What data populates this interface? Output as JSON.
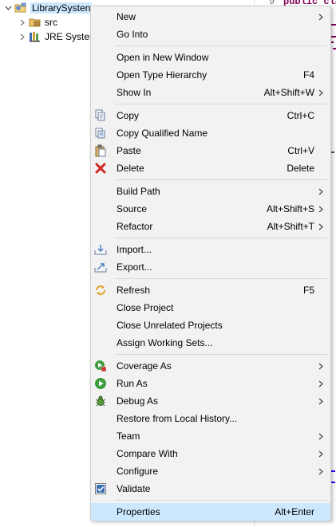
{
  "explorer": {
    "project": {
      "label": "LibrarySysten"
    },
    "items": [
      {
        "label": "src"
      },
      {
        "label": "JRE System"
      }
    ]
  },
  "editor": {
    "line_number": "9",
    "code_fragment": "public cla"
  },
  "menu": {
    "items": [
      {
        "label": "New",
        "shortcut": "",
        "submenu": true,
        "icon": ""
      },
      {
        "label": "Go Into",
        "shortcut": "",
        "submenu": false,
        "icon": ""
      },
      {
        "label": "Open in New Window",
        "shortcut": "",
        "submenu": false,
        "icon": ""
      },
      {
        "label": "Open Type Hierarchy",
        "shortcut": "F4",
        "submenu": false,
        "icon": ""
      },
      {
        "label": "Show In",
        "shortcut": "Alt+Shift+W",
        "submenu": true,
        "icon": ""
      },
      {
        "label": "Copy",
        "shortcut": "Ctrl+C",
        "submenu": false,
        "icon": "copy-icon"
      },
      {
        "label": "Copy Qualified Name",
        "shortcut": "",
        "submenu": false,
        "icon": "copy-qualified-name-icon"
      },
      {
        "label": "Paste",
        "shortcut": "Ctrl+V",
        "submenu": false,
        "icon": "paste-icon"
      },
      {
        "label": "Delete",
        "shortcut": "Delete",
        "submenu": false,
        "icon": "delete-icon"
      },
      {
        "label": "Build Path",
        "shortcut": "",
        "submenu": true,
        "icon": ""
      },
      {
        "label": "Source",
        "shortcut": "Alt+Shift+S",
        "submenu": true,
        "icon": ""
      },
      {
        "label": "Refactor",
        "shortcut": "Alt+Shift+T",
        "submenu": true,
        "icon": ""
      },
      {
        "label": "Import...",
        "shortcut": "",
        "submenu": false,
        "icon": "import-icon"
      },
      {
        "label": "Export...",
        "shortcut": "",
        "submenu": false,
        "icon": "export-icon"
      },
      {
        "label": "Refresh",
        "shortcut": "F5",
        "submenu": false,
        "icon": "refresh-icon"
      },
      {
        "label": "Close Project",
        "shortcut": "",
        "submenu": false,
        "icon": ""
      },
      {
        "label": "Close Unrelated Projects",
        "shortcut": "",
        "submenu": false,
        "icon": ""
      },
      {
        "label": "Assign Working Sets...",
        "shortcut": "",
        "submenu": false,
        "icon": ""
      },
      {
        "label": "Coverage As",
        "shortcut": "",
        "submenu": true,
        "icon": "coverage-icon"
      },
      {
        "label": "Run As",
        "shortcut": "",
        "submenu": true,
        "icon": "run-icon"
      },
      {
        "label": "Debug As",
        "shortcut": "",
        "submenu": true,
        "icon": "debug-icon"
      },
      {
        "label": "Restore from Local History...",
        "shortcut": "",
        "submenu": false,
        "icon": ""
      },
      {
        "label": "Team",
        "shortcut": "",
        "submenu": true,
        "icon": ""
      },
      {
        "label": "Compare With",
        "shortcut": "",
        "submenu": true,
        "icon": ""
      },
      {
        "label": "Configure",
        "shortcut": "",
        "submenu": true,
        "icon": ""
      },
      {
        "label": "Validate",
        "shortcut": "",
        "submenu": false,
        "icon": "checkbox-checked-icon"
      },
      {
        "label": "Properties",
        "shortcut": "Alt+Enter",
        "submenu": false,
        "icon": "",
        "selected": true
      }
    ]
  },
  "colors": {
    "menu_bg": "#f2f2f2",
    "selection": "#cce8ff",
    "separator": "#d7d7d7",
    "keyword": "#7f0055"
  }
}
